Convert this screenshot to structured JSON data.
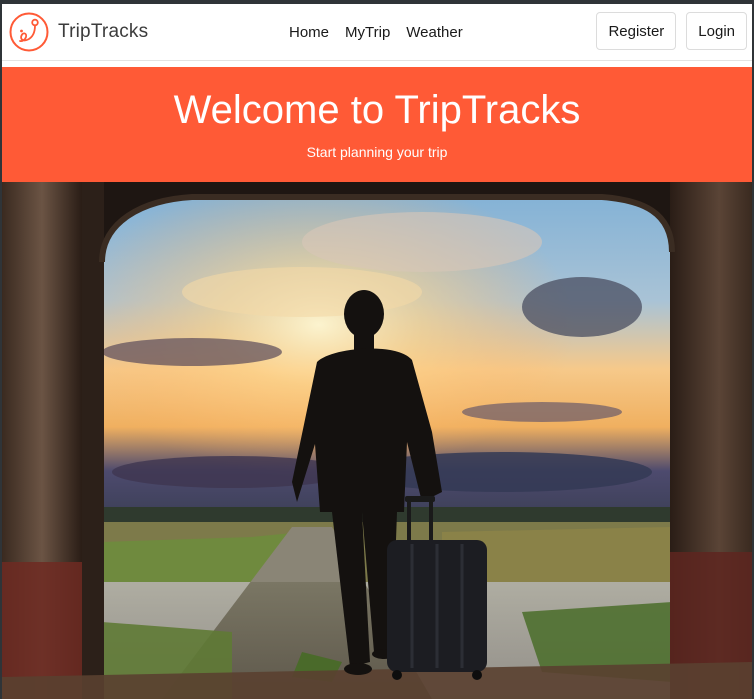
{
  "brand": {
    "name": "TripTracks",
    "logo_icon": "map-pin-route-icon"
  },
  "nav": {
    "links": [
      {
        "label": "Home"
      },
      {
        "label": "MyTrip"
      },
      {
        "label": "Weather"
      }
    ],
    "register_label": "Register",
    "login_label": "Login"
  },
  "hero": {
    "title": "Welcome to TripTracks",
    "subtitle": "Start planning your trip",
    "background_color": "#ff5a36"
  },
  "banner_image": {
    "subject": "traveler-with-suitcase-under-archway-at-sunset"
  },
  "colors": {
    "accent": "#ff5a36",
    "text": "#1a1a1a"
  }
}
